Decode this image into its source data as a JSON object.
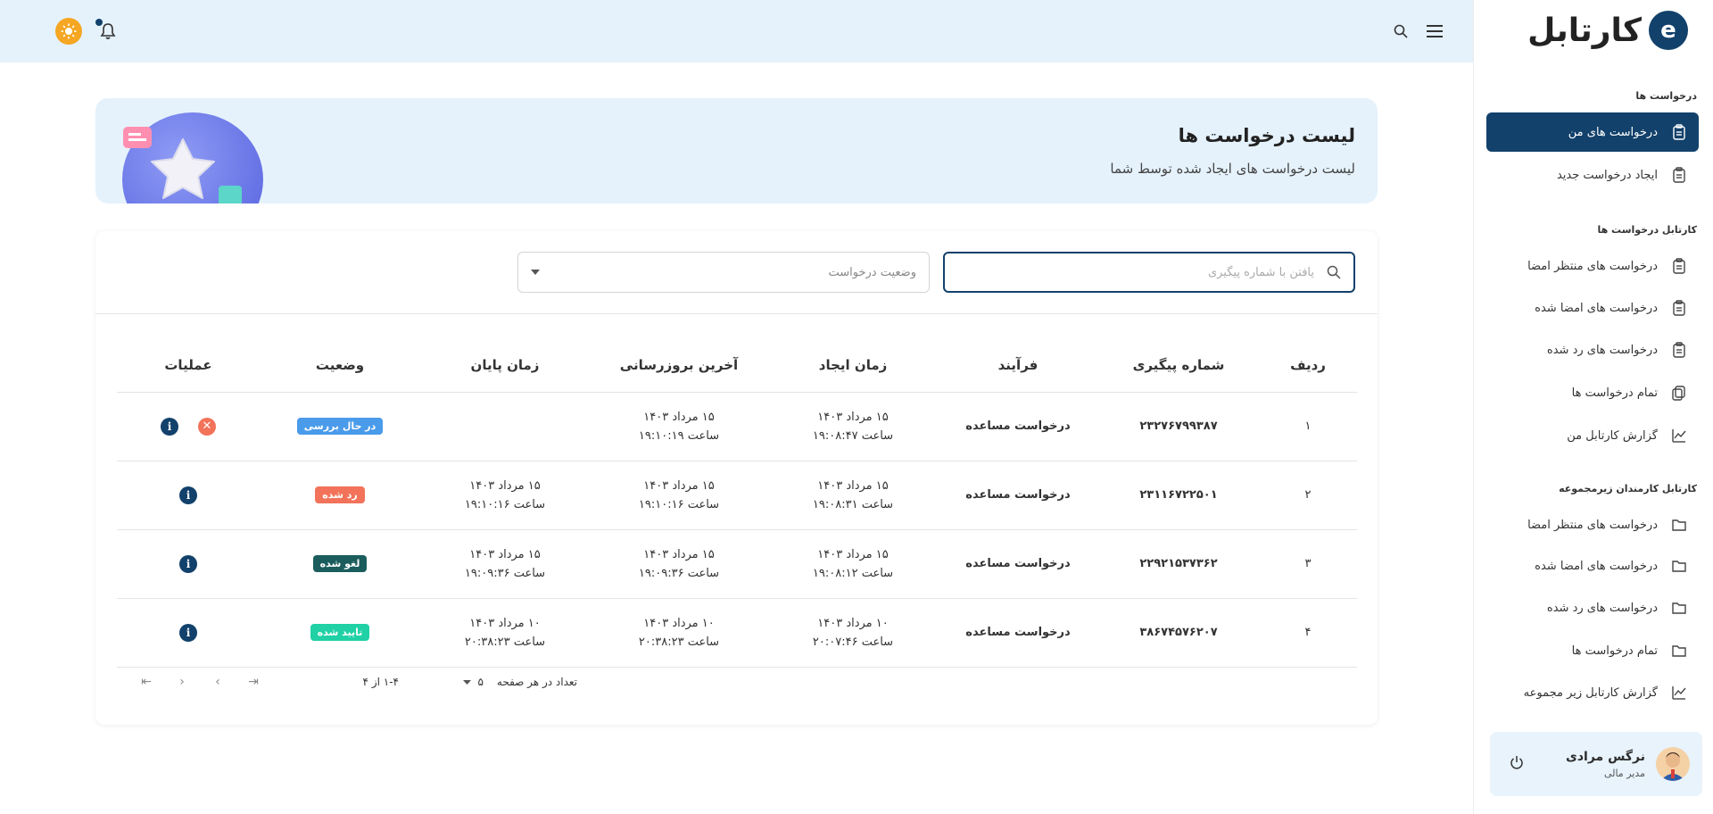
{
  "sidebar": {
    "logo_text": "کارتابل",
    "sections": [
      {
        "title": "درخواست ها"
      },
      {
        "title": "کارتابل درخواست ها"
      },
      {
        "title": "کارتابل کارمندان زیرمجموعه"
      }
    ],
    "items": [
      {
        "label": "درخواست های من",
        "icon": "clipboard-icon",
        "active": true
      },
      {
        "label": "ایجاد درخواست جدید",
        "icon": "clipboard-add-icon"
      },
      {
        "label": "درخواست های منتظر امضا",
        "icon": "file-search-icon"
      },
      {
        "label": "درخواست های امضا شده",
        "icon": "file-sign-icon"
      },
      {
        "label": "درخواست های رد شده",
        "icon": "file-reject-icon"
      },
      {
        "label": "تمام درخواست ها",
        "icon": "copy-icon"
      },
      {
        "label": "گزارش کارتابل من",
        "icon": "chart-icon"
      },
      {
        "label": "درخواست های منتظر امضا",
        "icon": "folder-search-icon"
      },
      {
        "label": "درخواست های امضا شده",
        "icon": "folder-check-icon"
      },
      {
        "label": "درخواست های رد شده",
        "icon": "folder-x-icon"
      },
      {
        "label": "تمام درخواست ها",
        "icon": "folders-icon"
      },
      {
        "label": "گزارش کارتابل زیر مجموعه",
        "icon": "chart-icon"
      }
    ],
    "user": {
      "name": "نرگس مرادی",
      "role": "مدیر مالی"
    }
  },
  "banner": {
    "title": "لیست درخواست ها",
    "subtitle": "لیست درخواست های ایجاد شده توسط شما"
  },
  "filters": {
    "search_placeholder": "یافتن با شماره پیگیری",
    "status_placeholder": "وضعیت درخواست"
  },
  "table": {
    "headers": [
      "ردیف",
      "شماره پیگیری",
      "فرآیند",
      "زمان ایجاد",
      "آخرین بروزرسانی",
      "زمان پایان",
      "وضعیت",
      "عملیات"
    ],
    "rows": [
      {
        "row": "۱",
        "tracking": "۲۳۲۷۶۷۹۹۳۸۷",
        "process": "درخواست مساعده",
        "created_d": "۱۵ مرداد ۱۴۰۳",
        "created_t": "ساعت ۱۹:۰۸:۴۷",
        "updated_d": "۱۵ مرداد ۱۴۰۳",
        "updated_t": "ساعت ۱۹:۱۰:۱۹",
        "end_d": "",
        "end_t": "",
        "status": "در حال بررسی",
        "status_color": "#4a9bea",
        "cancelable": true
      },
      {
        "row": "۲",
        "tracking": "۲۳۱۱۶۷۲۲۵۰۱",
        "process": "درخواست مساعده",
        "created_d": "۱۵ مرداد ۱۴۰۳",
        "created_t": "ساعت ۱۹:۰۸:۳۱",
        "updated_d": "۱۵ مرداد ۱۴۰۳",
        "updated_t": "ساعت ۱۹:۱۰:۱۶",
        "end_d": "۱۵ مرداد ۱۴۰۳",
        "end_t": "ساعت ۱۹:۱۰:۱۶",
        "status": "رد شده",
        "status_color": "#f2735a",
        "cancelable": false
      },
      {
        "row": "۳",
        "tracking": "۲۲۹۲۱۵۳۷۳۶۲",
        "process": "درخواست مساعده",
        "created_d": "۱۵ مرداد ۱۴۰۳",
        "created_t": "ساعت ۱۹:۰۸:۱۲",
        "updated_d": "۱۵ مرداد ۱۴۰۳",
        "updated_t": "ساعت ۱۹:۰۹:۳۶",
        "end_d": "۱۵ مرداد ۱۴۰۳",
        "end_t": "ساعت ۱۹:۰۹:۳۶",
        "status": "لغو شده",
        "status_color": "#1b5d5d",
        "cancelable": false
      },
      {
        "row": "۴",
        "tracking": "۳۸۶۷۴۵۷۶۲۰۷",
        "process": "درخواست مساعده",
        "created_d": "۱۰ مرداد ۱۴۰۳",
        "created_t": "ساعت ۲۰:۰۷:۴۶",
        "updated_d": "۱۰ مرداد ۱۴۰۳",
        "updated_t": "ساعت ۲۰:۳۸:۲۳",
        "end_d": "۱۰ مرداد ۱۴۰۳",
        "end_t": "ساعت ۲۰:۳۸:۲۳",
        "status": "تایید شده",
        "status_color": "#1fd1a5",
        "cancelable": false
      }
    ]
  },
  "pagination": {
    "per_page_label": "تعداد در هر صفحه",
    "per_page_value": "۵",
    "range_text": "۱-۴ از ۴"
  },
  "colors": {
    "primary": "#12416b",
    "accent_bg": "#e5f2fc",
    "sun": "#f5a623"
  }
}
